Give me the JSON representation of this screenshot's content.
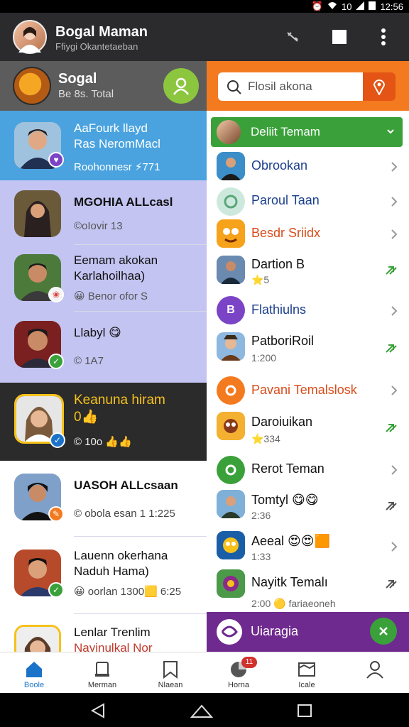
{
  "status_bar": {
    "time": "12:56",
    "battery_label": "10"
  },
  "app_bar": {
    "title": "Bogal Maman",
    "subtitle": "Ffiygi Okantetaeban"
  },
  "left_header": {
    "title": "Sogal",
    "subtitle": "Be 8s. Total"
  },
  "chats": [
    {
      "name_line1": "AaFourk llayd",
      "name_line2": "Ras NeromMacl",
      "meta": "Roohonnesr ⚡771",
      "bg": "#4aa3df"
    },
    {
      "name_line1": "MGOHIA ALLcasl",
      "name_line2": "",
      "meta": "©oIovir 13",
      "bg": "#c3c4f2"
    },
    {
      "name_line1": "Eemam akokan",
      "name_line2": "Karlahoilhaa)",
      "meta": "😀 Benor ofor S",
      "bg": "#c3c4f2"
    },
    {
      "name_line1": "Llabyl 😋",
      "name_line2": "",
      "meta": "© 1A7",
      "bg": "#c3c4f2"
    },
    {
      "name_line1": "Keanuna hiram",
      "name_line2": "0👍",
      "meta": "© 10o 👍👍",
      "bg": "#2b2b2b"
    },
    {
      "name_line1": "UASOH ALLcsaan",
      "name_line2": "",
      "meta": "© obola esan 1 1:225",
      "bg": "#ffffff"
    },
    {
      "name_line1": "Lauenn okerhana",
      "name_line2": "Naduh Hama)",
      "meta": "😀 oorlan 1300🟨 6:25",
      "bg": "#ffffff"
    },
    {
      "name_line1": "Lenlar Trenlim",
      "name_line2": "Nayinulkal Nor",
      "meta": "",
      "bg": "#ffffff"
    }
  ],
  "search": {
    "placeholder": "Flosil akona"
  },
  "friend_header": {
    "label": "Deliit Temam"
  },
  "friends": [
    {
      "label": "Obrookan",
      "sub": "",
      "color": "#1b3f8c"
    },
    {
      "label": "Paroul Taan",
      "sub": "",
      "color": "#1b3f8c"
    },
    {
      "label": "Besdr Sriidх",
      "sub": "",
      "color": "#d94c1a"
    },
    {
      "label": "Dartion B",
      "sub": "⭐5",
      "color": "#111111"
    },
    {
      "label": "Flathiulns",
      "sub": "",
      "color": "#1b3f8c"
    },
    {
      "label": "PatboriRoil",
      "sub": "1:200",
      "color": "#111111"
    },
    {
      "label": "Pavani Temalslosk",
      "sub": "",
      "color": "#d94c1a"
    },
    {
      "label": "Daroiuikan",
      "sub": "⭐334",
      "color": "#111111"
    },
    {
      "label": "Rerot Teman",
      "sub": "",
      "color": "#111111"
    },
    {
      "label": "Tomtyl 😋😋",
      "sub": "2:36",
      "color": "#111111"
    },
    {
      "label": "Aeeal 😍😍🟧",
      "sub": "1:33",
      "color": "#111111"
    },
    {
      "label": "Nayitk Temalı",
      "sub": "2:00 🟡 fariaeoneh",
      "color": "#111111"
    }
  ],
  "purple_bar": {
    "label": "Uiaragia"
  },
  "bottom_nav": [
    {
      "label": "Boole"
    },
    {
      "label": "Merman"
    },
    {
      "label": "Nlaean"
    },
    {
      "label": "Horna"
    },
    {
      "label": "Icale"
    },
    {
      "label": ""
    }
  ],
  "badges": {
    "notification_count": "11"
  },
  "colors": {
    "accent_orange": "#f47a20",
    "accent_green": "#3aa13a",
    "accent_blue": "#1b73c9",
    "accent_purple": "#6f2a8f"
  }
}
